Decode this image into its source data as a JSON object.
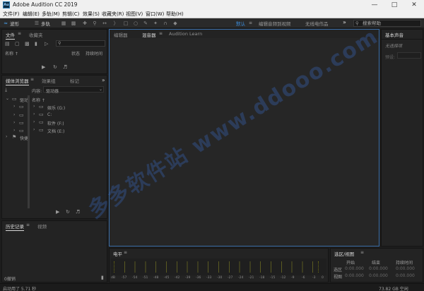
{
  "window": {
    "logo_text": "Au",
    "title": "Adobe Audition CC 2019"
  },
  "menu": [
    "文件(F)",
    "编辑(E)",
    "多轨(M)",
    "剪辑(C)",
    "效果(S)",
    "收藏夹(R)",
    "视图(V)",
    "窗口(W)",
    "帮助(H)"
  ],
  "toolbar": {
    "waveform_label": "波形",
    "multitrack_label": "多轨",
    "workspaces": [
      "默认",
      "编辑音频到视频",
      "无线电作品"
    ],
    "more": "»",
    "search_placeholder": "搜索帮助"
  },
  "files_panel": {
    "tabs": [
      "文件",
      "收藏夹"
    ],
    "col_name": "名称 ↑",
    "col_status": "状态",
    "col_duration": "持续时间"
  },
  "media_browser": {
    "tabs": [
      "媒体浏览器",
      "效果组",
      "标记"
    ],
    "content_label": "内容:",
    "content_value": "驱动器",
    "tree_items": [
      "驱动",
      "快捷"
    ],
    "col_name": "名称 ↑",
    "drives": [
      "娱乐 (G:)",
      "C:",
      "软件 (F:)",
      "文档 (E:)"
    ]
  },
  "history_panel": {
    "tabs": [
      "历史记录",
      "视频"
    ],
    "undo_count": "0撤销"
  },
  "editor": {
    "tabs": [
      "编辑器",
      "混音器",
      "Audition Learn"
    ]
  },
  "essential_sound": {
    "title": "基本声音",
    "no_selection": "无选择项",
    "preset_label": "预设:"
  },
  "levels": {
    "title": "电平",
    "ticks": [
      "dB",
      "-57",
      "-54",
      "-51",
      "-48",
      "-45",
      "-42",
      "-39",
      "-36",
      "-33",
      "-30",
      "-27",
      "-24",
      "-21",
      "-18",
      "-15",
      "-12",
      "-9",
      "-6",
      "-3",
      "0"
    ]
  },
  "selection_panel": {
    "title": "选区/视图",
    "headers": [
      "开始",
      "结束",
      "持续时间"
    ],
    "rows": [
      {
        "label": "选区",
        "start": "0:00.000",
        "end": "0:00.000",
        "dur": "0:00.000"
      },
      {
        "label": "视图",
        "start": "0:00.000",
        "end": "0:00.000",
        "dur": "0:00.000"
      }
    ]
  },
  "status": {
    "left": "启动用了 5.71 秒",
    "right": "73.82 GB 空闲"
  },
  "watermark": "多多软件站 www.ddooo.com",
  "colors": {
    "accent": "#3b8fe0",
    "panel_bg": "#232323",
    "app_bg": "#1d1d1d"
  }
}
